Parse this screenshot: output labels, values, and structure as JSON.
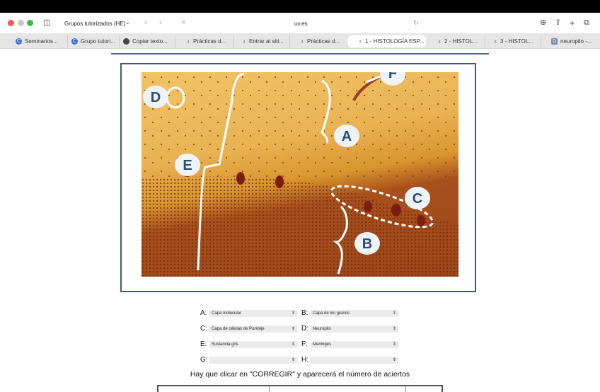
{
  "browser": {
    "tab_group": "Grupos tutorizados (HE)",
    "url": "uv.es",
    "tabs": [
      {
        "label": "Seminarios..."
      },
      {
        "label": "Grupo tutori..."
      },
      {
        "label": "Copiar texto..."
      },
      {
        "label": "Prácticas d..."
      },
      {
        "label": "Entrar al siti..."
      },
      {
        "label": "Prácticas d..."
      },
      {
        "label": "1 - HISTOLOGÍA ESP..."
      },
      {
        "label": "2 - HISTOL..."
      },
      {
        "label": "3 - HISTOL..."
      },
      {
        "label": "neuropilo -..."
      }
    ]
  },
  "image": {
    "labels": [
      "A",
      "B",
      "C",
      "D",
      "E",
      "F"
    ]
  },
  "quiz": {
    "rows": [
      {
        "l1": "A:",
        "v1": "Capa molecular",
        "l2": "B:",
        "v2": "Capa de los granos"
      },
      {
        "l1": "C:",
        "v1": "Capa de células de Purkinje",
        "l2": "D:",
        "v2": "Neuropilo"
      },
      {
        "l1": "E:",
        "v1": "Sustancia gris",
        "l2": "F:",
        "v2": "Meninges"
      },
      {
        "l1": "G:",
        "v1": "",
        "l2": "H:",
        "v2": ""
      }
    ],
    "note": "Hay que clicar en \"CORREGIR\" y aparecerá el número de aciertos"
  },
  "colors": {
    "frame": "#3f5a7c",
    "label_fill": "#eef3f8",
    "label_text": "#2d4d6e"
  }
}
